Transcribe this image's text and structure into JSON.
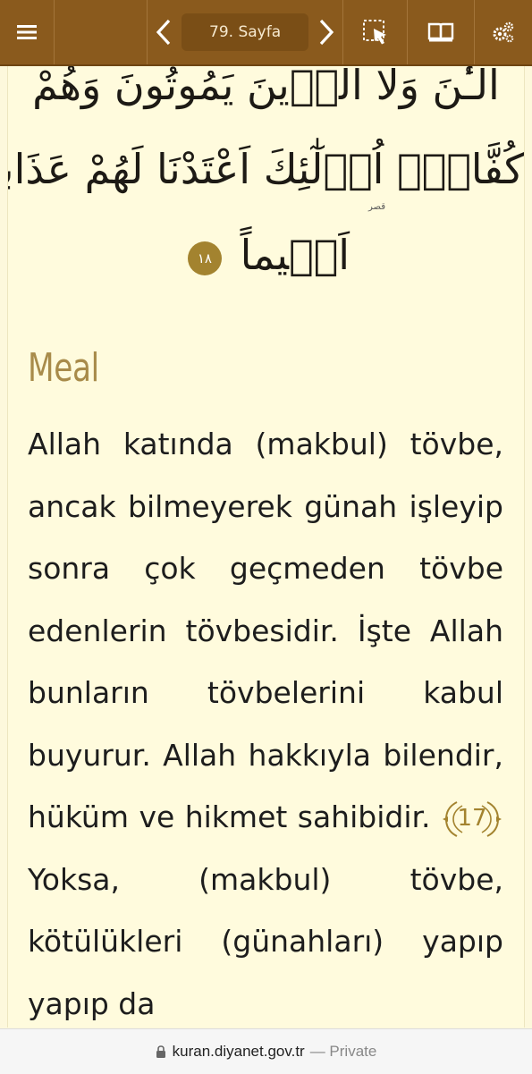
{
  "toolbar": {
    "page_label": "79. Sayfa",
    "colors": {
      "bar": "#8a5a1d",
      "pill": "#7a4e16"
    },
    "icons": [
      "hamburger-menu-icon",
      "chevron-left-icon",
      "chevron-right-icon",
      "selection-icon",
      "open-book-icon",
      "gears-icon"
    ]
  },
  "arabic": {
    "line1": "الْـٰٔنَ وَلَا الَّذ۪ينَ يَمُوتُونَ وَهُمْ",
    "line2": "كُفَّارٌۜ اُو۬لٰٓئِكَ اَعْتَدْنَا لَهُمْ عَذَاباً",
    "line3": "اَل۪يماً",
    "ayah_number": "١٨",
    "note": "قصر"
  },
  "meal": {
    "heading": "Meal",
    "text_part1": "Allah katında (makbul) tövbe, ancak bilmeyerek günah işleyip sonra çok geçmeden tövbe edenlerin tövbesidir. İşte Allah bunların tövbelerini kabul buyurur. Allah hakkıyla bilendir, hüküm ve hikmet sahibidir.",
    "verse_number": "17",
    "text_part2": "Yoksa, (makbul) tövbe, kötülükleri (günahları) yapıp yapıp da",
    "accent_color": "#a3832f"
  },
  "urlbar": {
    "domain": "kuran.diyanet.gov.tr",
    "suffix": "— Private"
  }
}
